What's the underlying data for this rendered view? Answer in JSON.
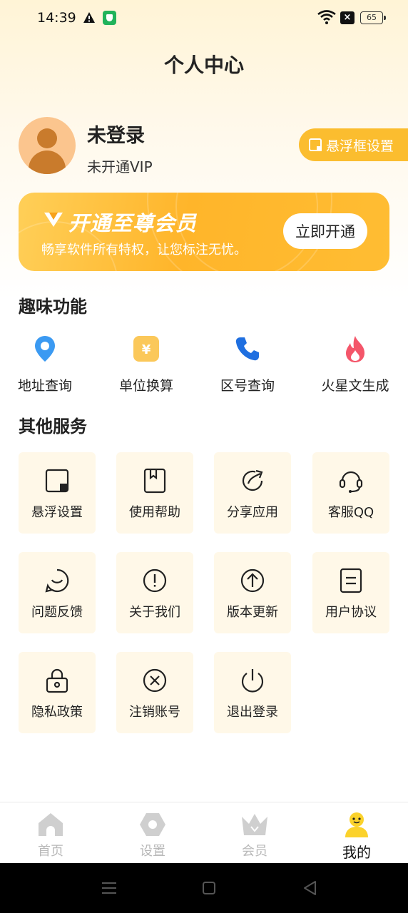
{
  "status_bar": {
    "time": "14:39",
    "battery": "65"
  },
  "page": {
    "title": "个人中心"
  },
  "profile": {
    "name": "未登录",
    "vip_status": "未开通VIP",
    "float_button": "悬浮框设置"
  },
  "vip_banner": {
    "title": "开通至尊会员",
    "description": "畅享软件所有特权，让您标注无忧。",
    "button": "立即开通"
  },
  "fun_section": {
    "title": "趣味功能",
    "items": [
      {
        "label": "地址查询",
        "icon": "location-pin-icon"
      },
      {
        "label": "单位换算",
        "icon": "yen-currency-icon"
      },
      {
        "label": "区号查询",
        "icon": "phone-icon"
      },
      {
        "label": "火星文生成",
        "icon": "flame-icon"
      }
    ]
  },
  "services_section": {
    "title": "其他服务",
    "items": [
      {
        "label": "悬浮设置",
        "icon": "floating-window-icon"
      },
      {
        "label": "使用帮助",
        "icon": "help-book-icon"
      },
      {
        "label": "分享应用",
        "icon": "share-icon"
      },
      {
        "label": "客服QQ",
        "icon": "headset-icon"
      },
      {
        "label": "问题反馈",
        "icon": "feedback-icon"
      },
      {
        "label": "关于我们",
        "icon": "info-exclamation-icon"
      },
      {
        "label": "版本更新",
        "icon": "update-arrow-icon"
      },
      {
        "label": "用户协议",
        "icon": "document-icon"
      },
      {
        "label": "隐私政策",
        "icon": "lock-icon"
      },
      {
        "label": "注销账号",
        "icon": "close-circle-icon"
      },
      {
        "label": "退出登录",
        "icon": "power-icon"
      }
    ]
  },
  "bottom_nav": {
    "items": [
      {
        "label": "首页",
        "icon": "home-icon",
        "active": false
      },
      {
        "label": "设置",
        "icon": "settings-hexagon-icon",
        "active": false
      },
      {
        "label": "会员",
        "icon": "crown-icon",
        "active": false
      },
      {
        "label": "我的",
        "icon": "user-icon",
        "active": true
      }
    ]
  },
  "colors": {
    "accent": "#fbbd2f",
    "card_bg": "#fff8e8",
    "inactive_nav": "#b8b8b8"
  }
}
